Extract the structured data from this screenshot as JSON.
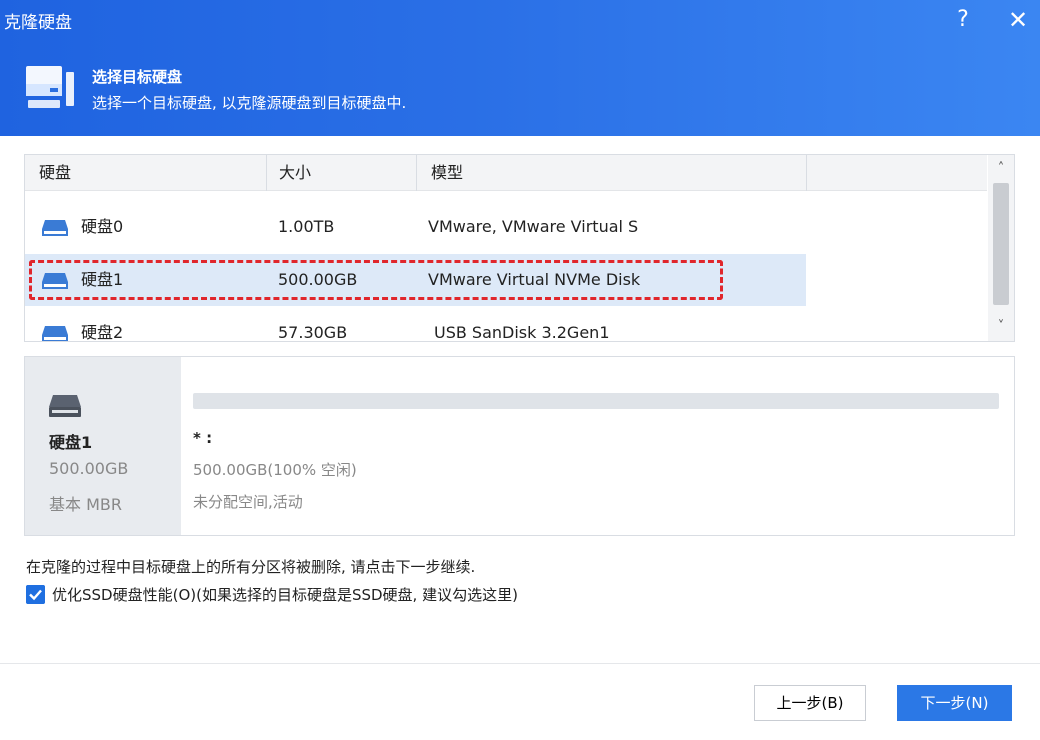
{
  "window": {
    "title": "克隆硬盘",
    "help_label": "?",
    "close_label": "✕"
  },
  "header": {
    "title": "选择目标硬盘",
    "subtitle": "选择一个目标硬盘, 以克隆源硬盘到目标硬盘中."
  },
  "table": {
    "columns": [
      "硬盘",
      "大小",
      "模型"
    ],
    "rows": [
      {
        "name": "硬盘0",
        "size": "1.00TB",
        "model": "VMware, VMware Virtual S"
      },
      {
        "name": "硬盘1",
        "size": "500.00GB",
        "model": "VMware Virtual NVMe Disk"
      },
      {
        "name": "硬盘2",
        "size": "57.30GB",
        "model": "USB SanDisk 3.2Gen1"
      }
    ],
    "selected_index": 1,
    "scroll_up": "˄",
    "scroll_down": "˅"
  },
  "detail": {
    "disk_name": "硬盘1",
    "disk_size": "500.00GB",
    "disk_type": "基本 MBR",
    "partition_label": "* :",
    "partition_info": "500.00GB(100% 空闲)",
    "partition_status": "未分配空间,活动"
  },
  "notice": {
    "warning": "在克隆的过程中目标硬盘上的所有分区将被删除, 请点击下一步继续.",
    "optimize_ssd_label": "优化SSD硬盘性能(O)(如果选择的目标硬盘是SSD硬盘, 建议勾选这里)",
    "optimize_ssd_checked": true
  },
  "buttons": {
    "prev": "上一步(B)",
    "next": "下一步(N)"
  },
  "colors": {
    "header_start": "#1f63e0",
    "header_end": "#3b86f2",
    "primary_button": "#2b78e6",
    "selection_outline": "#e0262c",
    "selected_row": "#dde9f8"
  }
}
